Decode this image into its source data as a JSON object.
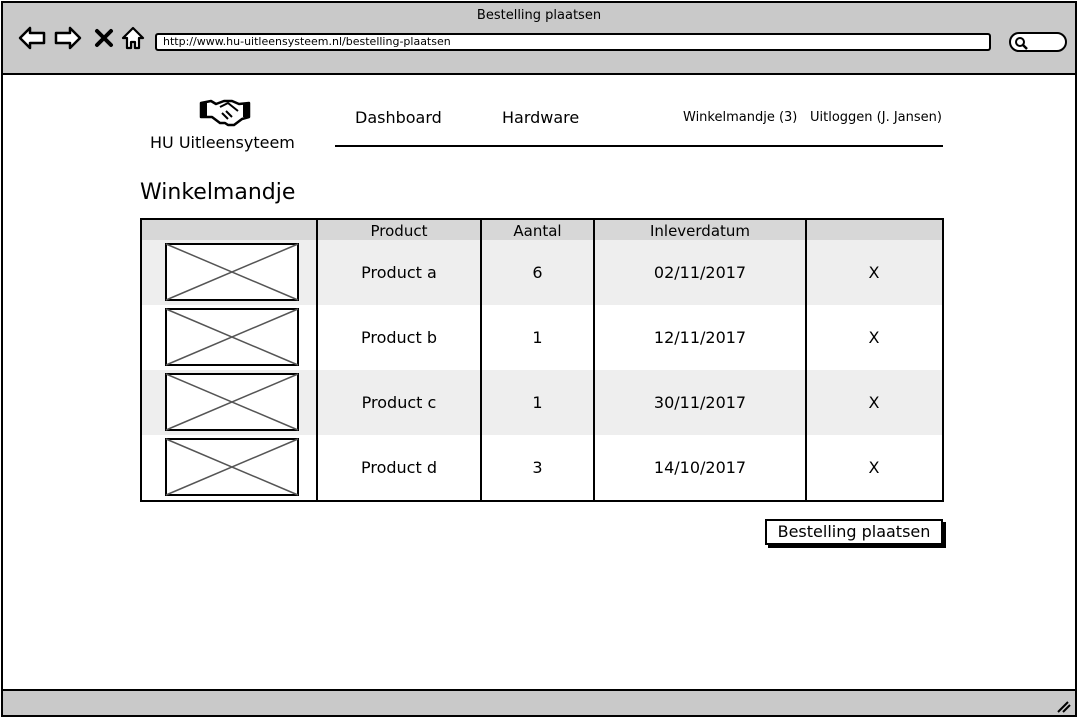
{
  "window": {
    "title": "Bestelling plaatsen",
    "url": "http://www.hu-uitleensysteem.nl/bestelling-plaatsen"
  },
  "browser_icons": [
    "back-icon",
    "forward-icon",
    "close-icon",
    "home-icon",
    "search-icon"
  ],
  "header": {
    "app_name": "HU Uitleensyteem",
    "logo_icon": "handshake-icon",
    "nav": {
      "dashboard": "Dashboard",
      "hardware": "Hardware",
      "cart": "Winkelmandje (3)",
      "logout": "Uitloggen (J. Jansen)"
    }
  },
  "page": {
    "title": "Winkelmandje"
  },
  "table": {
    "columns": [
      "",
      "Product",
      "Aantal",
      "Inleverdatum",
      ""
    ],
    "rows": [
      {
        "product": "Product a",
        "aantal": "6",
        "inleverdatum": "02/11/2017",
        "remove": "X"
      },
      {
        "product": "Product b",
        "aantal": "1",
        "inleverdatum": "12/11/2017",
        "remove": "X"
      },
      {
        "product": "Product c",
        "aantal": "1",
        "inleverdatum": "30/11/2017",
        "remove": "X"
      },
      {
        "product": "Product d",
        "aantal": "3",
        "inleverdatum": "14/10/2017",
        "remove": "X"
      }
    ]
  },
  "actions": {
    "place_order": "Bestelling plaatsen"
  },
  "colors": {
    "chrome": "#c9c9c9",
    "table_header": "#d7d7d7",
    "row_shade": "#eeeeee"
  }
}
